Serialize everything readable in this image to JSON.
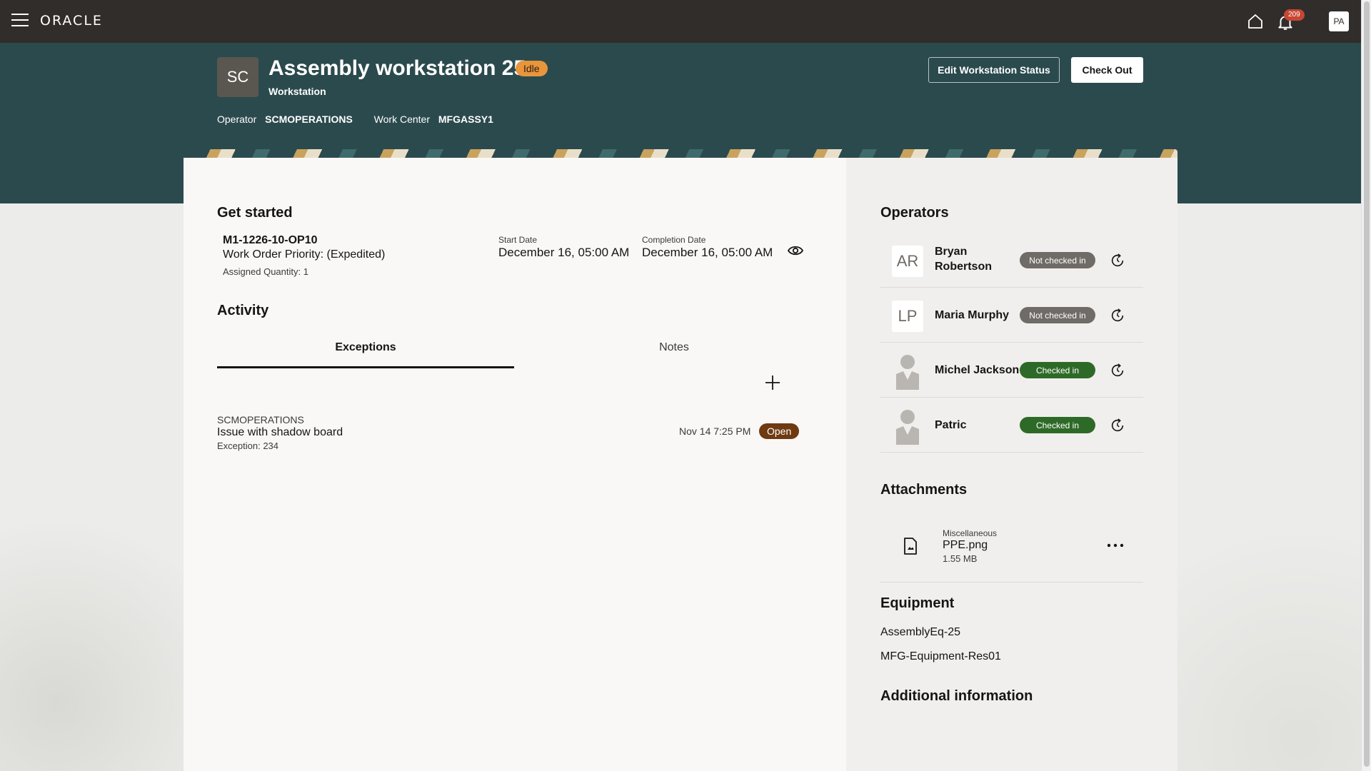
{
  "topbar": {
    "logo": "ORACLE",
    "notification_count": "209",
    "user_initials": "PA"
  },
  "header": {
    "avatar_initials": "SC",
    "title": "Assembly workstation 25",
    "status": "Idle",
    "subtitle": "Workstation",
    "operator_label": "Operator",
    "operator_value": "SCMOPERATIONS",
    "work_center_label": "Work Center",
    "work_center_value": "MFGASSY1",
    "edit_button": "Edit Workstation Status",
    "checkout_button": "Check Out"
  },
  "get_started": {
    "heading": "Get started",
    "work_order_id": "M1-1226-10-OP10",
    "priority": "Work Order Priority: (Expedited)",
    "assigned_quantity": "Assigned Quantity: 1",
    "start_date_label": "Start Date",
    "start_date_value": "December 16, 05:00 AM",
    "completion_date_label": "Completion Date",
    "completion_date_value": "December 16, 05:00 AM"
  },
  "activity": {
    "heading": "Activity",
    "tabs": [
      {
        "label": "Exceptions",
        "selected": true
      },
      {
        "label": "Notes",
        "selected": false
      }
    ],
    "exceptions": [
      {
        "user": "SCMOPERATIONS",
        "title": "Issue with shadow board",
        "number": "Exception: 234",
        "date": "Nov 14 7:25 PM",
        "status": "Open"
      }
    ]
  },
  "operators": {
    "heading": "Operators",
    "items": [
      {
        "initials": "AR",
        "name_line1": "Bryan",
        "name_line2": "Robertson",
        "status": "Not checked in"
      },
      {
        "initials": "LP",
        "name_line1": "Maria Murphy",
        "name_line2": "",
        "status": "Not checked in"
      },
      {
        "initials": "",
        "name_line1": "Michel Jackson",
        "name_line2": "",
        "status": "Checked in"
      },
      {
        "initials": "",
        "name_line1": "Patric",
        "name_line2": "",
        "status": "Checked in"
      }
    ]
  },
  "attachments": {
    "heading": "Attachments",
    "items": [
      {
        "category": "Miscellaneous",
        "name": "PPE.png",
        "size": "1.55 MB"
      }
    ]
  },
  "equipment": {
    "heading": "Equipment",
    "items": [
      "AssemblyEq-25",
      "MFG-Equipment-Res01"
    ]
  },
  "additional_info": {
    "heading": "Additional information"
  },
  "colors": {
    "topbar": "#312d2a",
    "band": "#2b4a4e",
    "idle": "#e8953c",
    "open": "#6e3a12",
    "checked_in": "#2e6a27",
    "not_checked_in": "#6f6b66"
  }
}
